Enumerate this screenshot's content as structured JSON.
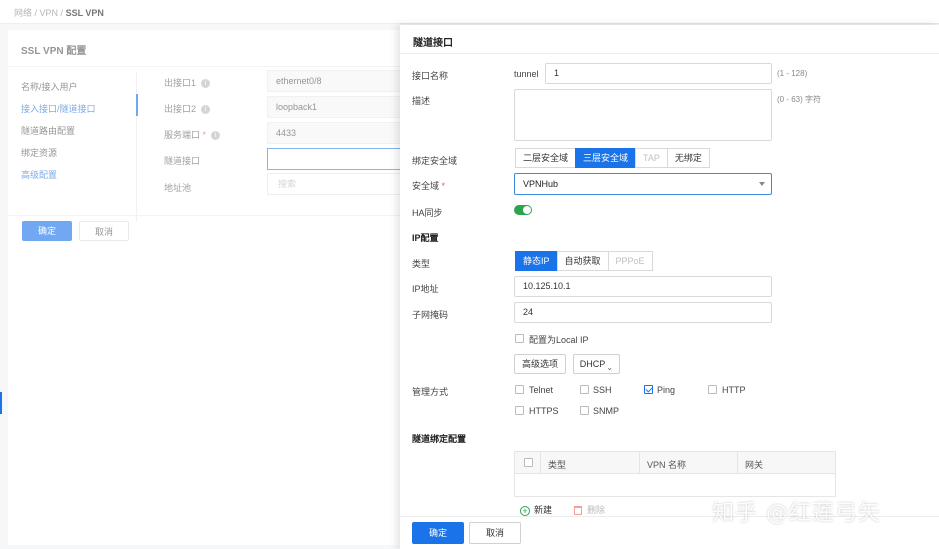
{
  "breadcrumb": {
    "part1": "网络",
    "sep": " / ",
    "part2": "VPN",
    "current": "SSL VPN"
  },
  "page": {
    "title": "SSL VPN 配置",
    "nav": [
      "名称/接入用户",
      "接入接口/隧道接口",
      "隧道路由配置",
      "绑定资源",
      "高级配置"
    ],
    "fields": [
      {
        "label": "出接口1",
        "value": "ethernet0/8"
      },
      {
        "label": "出接口2",
        "value": "loopback1"
      },
      {
        "label": "服务端口",
        "required": "*",
        "value": "4433"
      },
      {
        "label": "隧道接口",
        "value": ""
      },
      {
        "label": "地址池",
        "search_placeholder": "搜索"
      }
    ],
    "ok": "确定",
    "cancel": "取消"
  },
  "drawer": {
    "title": "隧道接口",
    "iface_name_label": "接口名称",
    "iface_prefix": "tunnel",
    "iface_value": "1",
    "iface_hint": "(1 - 128)",
    "desc_label": "描述",
    "desc_hint": "(0 - 63) 字符",
    "zone_bind_label": "绑定安全域",
    "zone_bind_options": [
      "二层安全域",
      "三层安全域",
      "TAP",
      "无绑定"
    ],
    "zone_label": "安全域",
    "zone_required": "*",
    "zone_value": "VPNHub",
    "ha_label": "HA同步",
    "ip_section": "IP配置",
    "type_label": "类型",
    "type_options": [
      "静态IP",
      "自动获取",
      "PPPoE"
    ],
    "ip_label": "IP地址",
    "ip_value": "10.125.10.1",
    "mask_label": "子网掩码",
    "mask_value": "24",
    "local_ip": "配置为Local IP",
    "adv_btn": "高级选项",
    "dhcp_btn": "DHCP",
    "mgmt_label": "管理方式",
    "mgmt": [
      {
        "name": "Telnet",
        "checked": false
      },
      {
        "name": "SSH",
        "checked": false
      },
      {
        "name": "Ping",
        "checked": true
      },
      {
        "name": "HTTP",
        "checked": false
      },
      {
        "name": "HTTPS",
        "checked": false
      },
      {
        "name": "SNMP",
        "checked": false
      }
    ],
    "tunnel_section": "隧道绑定配置",
    "table_cols": [
      "类型",
      "VPN 名称",
      "网关"
    ],
    "add": "新建",
    "delete": "删除",
    "ok": "确定",
    "cancel": "取消"
  },
  "watermark": "知乎 @红莲弓矢",
  "colors": {
    "primary": "#1a73e8",
    "toggle_on": "#2ea44f",
    "link": "#2f78d6"
  }
}
